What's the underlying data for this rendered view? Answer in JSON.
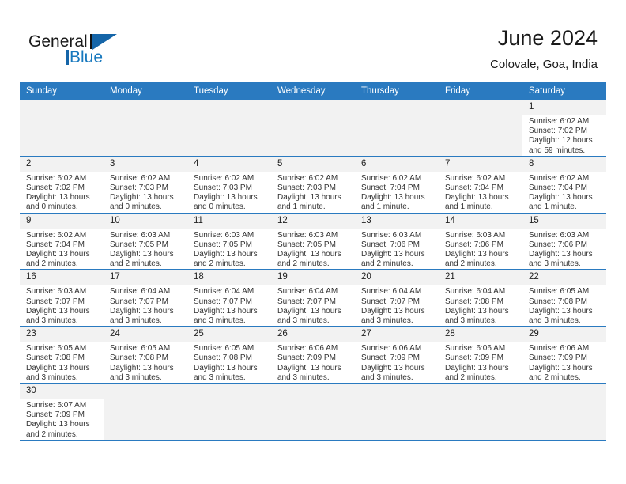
{
  "brand": {
    "line1": "General",
    "line2": "Blue",
    "accent_color": "#1778be"
  },
  "header": {
    "title": "June 2024",
    "subtitle": "Colovale, Goa, India"
  },
  "theme": {
    "header_bar_color": "#2a7ac0",
    "daynum_bg": "#f2f2f2",
    "grid_line_color": "#2a7ac0"
  },
  "weekday_headers": [
    "Sunday",
    "Monday",
    "Tuesday",
    "Wednesday",
    "Thursday",
    "Friday",
    "Saturday"
  ],
  "labels": {
    "sunrise": "Sunrise:",
    "sunset": "Sunset:",
    "daylight": "Daylight:"
  },
  "weeks": [
    [
      {
        "empty": true
      },
      {
        "empty": true
      },
      {
        "empty": true
      },
      {
        "empty": true
      },
      {
        "empty": true
      },
      {
        "empty": true
      },
      {
        "day": "1",
        "sunrise": "Sunrise: 6:02 AM",
        "sunset": "Sunset: 7:02 PM",
        "daylight": "Daylight: 12 hours and 59 minutes."
      }
    ],
    [
      {
        "day": "2",
        "sunrise": "Sunrise: 6:02 AM",
        "sunset": "Sunset: 7:02 PM",
        "daylight": "Daylight: 13 hours and 0 minutes."
      },
      {
        "day": "3",
        "sunrise": "Sunrise: 6:02 AM",
        "sunset": "Sunset: 7:03 PM",
        "daylight": "Daylight: 13 hours and 0 minutes."
      },
      {
        "day": "4",
        "sunrise": "Sunrise: 6:02 AM",
        "sunset": "Sunset: 7:03 PM",
        "daylight": "Daylight: 13 hours and 0 minutes."
      },
      {
        "day": "5",
        "sunrise": "Sunrise: 6:02 AM",
        "sunset": "Sunset: 7:03 PM",
        "daylight": "Daylight: 13 hours and 1 minute."
      },
      {
        "day": "6",
        "sunrise": "Sunrise: 6:02 AM",
        "sunset": "Sunset: 7:04 PM",
        "daylight": "Daylight: 13 hours and 1 minute."
      },
      {
        "day": "7",
        "sunrise": "Sunrise: 6:02 AM",
        "sunset": "Sunset: 7:04 PM",
        "daylight": "Daylight: 13 hours and 1 minute."
      },
      {
        "day": "8",
        "sunrise": "Sunrise: 6:02 AM",
        "sunset": "Sunset: 7:04 PM",
        "daylight": "Daylight: 13 hours and 1 minute."
      }
    ],
    [
      {
        "day": "9",
        "sunrise": "Sunrise: 6:02 AM",
        "sunset": "Sunset: 7:04 PM",
        "daylight": "Daylight: 13 hours and 2 minutes."
      },
      {
        "day": "10",
        "sunrise": "Sunrise: 6:03 AM",
        "sunset": "Sunset: 7:05 PM",
        "daylight": "Daylight: 13 hours and 2 minutes."
      },
      {
        "day": "11",
        "sunrise": "Sunrise: 6:03 AM",
        "sunset": "Sunset: 7:05 PM",
        "daylight": "Daylight: 13 hours and 2 minutes."
      },
      {
        "day": "12",
        "sunrise": "Sunrise: 6:03 AM",
        "sunset": "Sunset: 7:05 PM",
        "daylight": "Daylight: 13 hours and 2 minutes."
      },
      {
        "day": "13",
        "sunrise": "Sunrise: 6:03 AM",
        "sunset": "Sunset: 7:06 PM",
        "daylight": "Daylight: 13 hours and 2 minutes."
      },
      {
        "day": "14",
        "sunrise": "Sunrise: 6:03 AM",
        "sunset": "Sunset: 7:06 PM",
        "daylight": "Daylight: 13 hours and 2 minutes."
      },
      {
        "day": "15",
        "sunrise": "Sunrise: 6:03 AM",
        "sunset": "Sunset: 7:06 PM",
        "daylight": "Daylight: 13 hours and 3 minutes."
      }
    ],
    [
      {
        "day": "16",
        "sunrise": "Sunrise: 6:03 AM",
        "sunset": "Sunset: 7:07 PM",
        "daylight": "Daylight: 13 hours and 3 minutes."
      },
      {
        "day": "17",
        "sunrise": "Sunrise: 6:04 AM",
        "sunset": "Sunset: 7:07 PM",
        "daylight": "Daylight: 13 hours and 3 minutes."
      },
      {
        "day": "18",
        "sunrise": "Sunrise: 6:04 AM",
        "sunset": "Sunset: 7:07 PM",
        "daylight": "Daylight: 13 hours and 3 minutes."
      },
      {
        "day": "19",
        "sunrise": "Sunrise: 6:04 AM",
        "sunset": "Sunset: 7:07 PM",
        "daylight": "Daylight: 13 hours and 3 minutes."
      },
      {
        "day": "20",
        "sunrise": "Sunrise: 6:04 AM",
        "sunset": "Sunset: 7:07 PM",
        "daylight": "Daylight: 13 hours and 3 minutes."
      },
      {
        "day": "21",
        "sunrise": "Sunrise: 6:04 AM",
        "sunset": "Sunset: 7:08 PM",
        "daylight": "Daylight: 13 hours and 3 minutes."
      },
      {
        "day": "22",
        "sunrise": "Sunrise: 6:05 AM",
        "sunset": "Sunset: 7:08 PM",
        "daylight": "Daylight: 13 hours and 3 minutes."
      }
    ],
    [
      {
        "day": "23",
        "sunrise": "Sunrise: 6:05 AM",
        "sunset": "Sunset: 7:08 PM",
        "daylight": "Daylight: 13 hours and 3 minutes."
      },
      {
        "day": "24",
        "sunrise": "Sunrise: 6:05 AM",
        "sunset": "Sunset: 7:08 PM",
        "daylight": "Daylight: 13 hours and 3 minutes."
      },
      {
        "day": "25",
        "sunrise": "Sunrise: 6:05 AM",
        "sunset": "Sunset: 7:08 PM",
        "daylight": "Daylight: 13 hours and 3 minutes."
      },
      {
        "day": "26",
        "sunrise": "Sunrise: 6:06 AM",
        "sunset": "Sunset: 7:09 PM",
        "daylight": "Daylight: 13 hours and 3 minutes."
      },
      {
        "day": "27",
        "sunrise": "Sunrise: 6:06 AM",
        "sunset": "Sunset: 7:09 PM",
        "daylight": "Daylight: 13 hours and 3 minutes."
      },
      {
        "day": "28",
        "sunrise": "Sunrise: 6:06 AM",
        "sunset": "Sunset: 7:09 PM",
        "daylight": "Daylight: 13 hours and 2 minutes."
      },
      {
        "day": "29",
        "sunrise": "Sunrise: 6:06 AM",
        "sunset": "Sunset: 7:09 PM",
        "daylight": "Daylight: 13 hours and 2 minutes."
      }
    ],
    [
      {
        "day": "30",
        "sunrise": "Sunrise: 6:07 AM",
        "sunset": "Sunset: 7:09 PM",
        "daylight": "Daylight: 13 hours and 2 minutes."
      },
      {
        "empty": true
      },
      {
        "empty": true
      },
      {
        "empty": true
      },
      {
        "empty": true
      },
      {
        "empty": true
      },
      {
        "empty": true
      }
    ]
  ]
}
